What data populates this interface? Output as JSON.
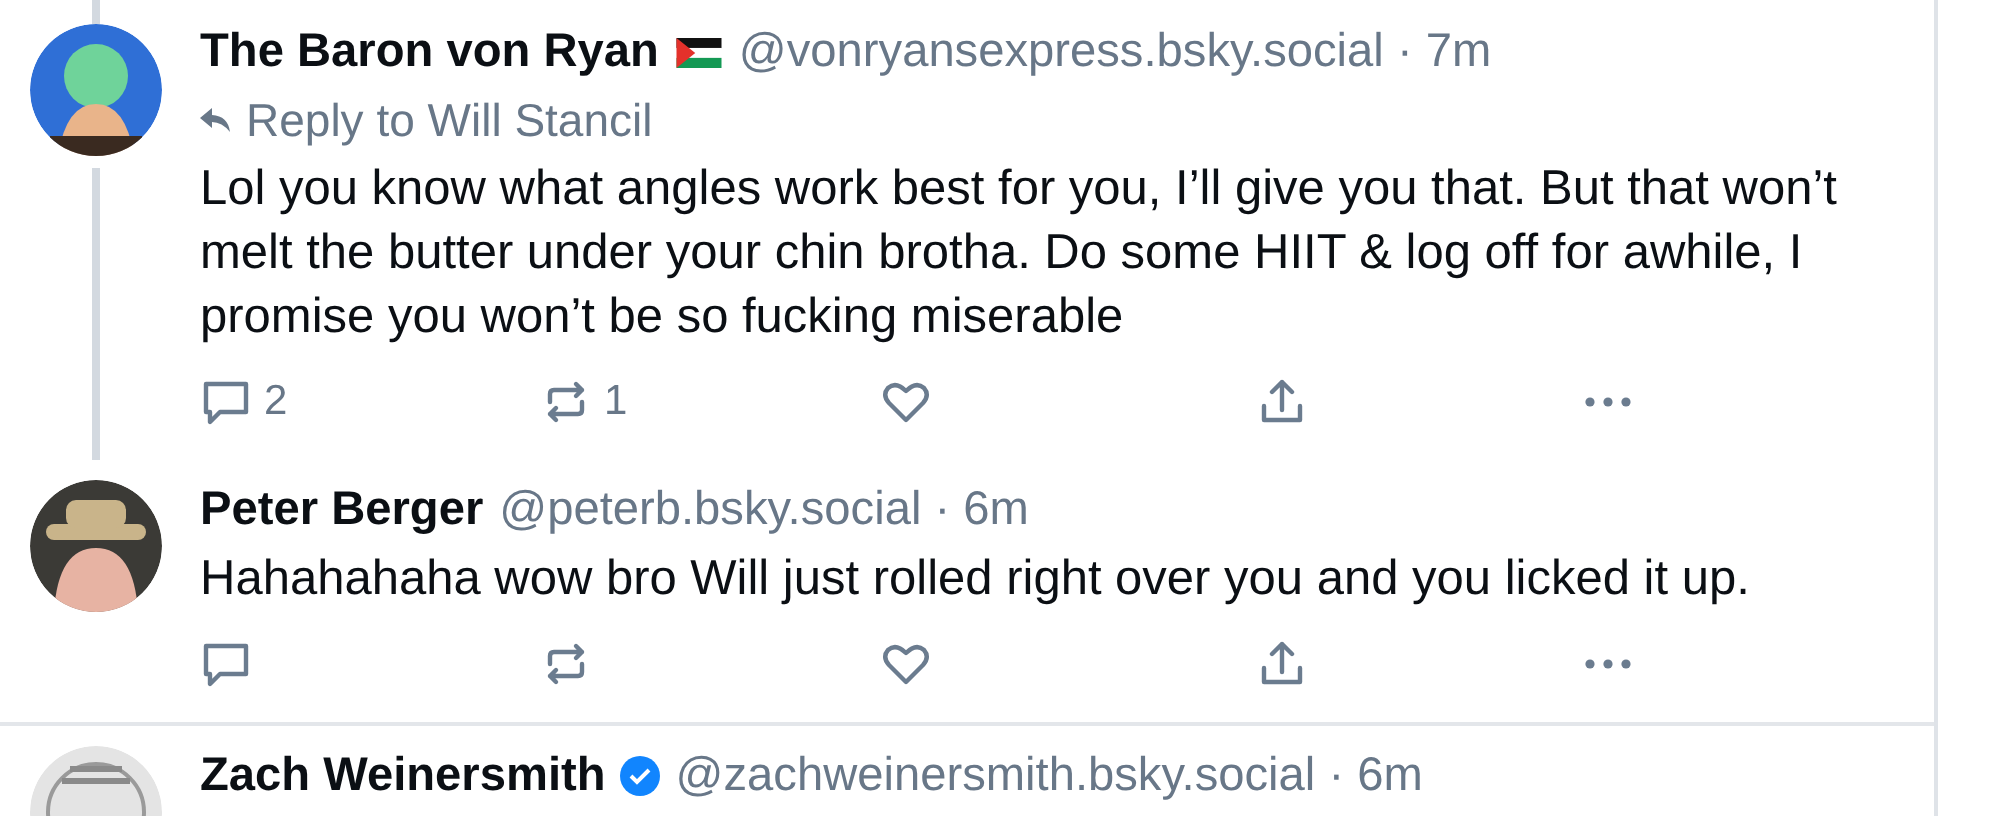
{
  "posts": [
    {
      "display_name": "The Baron von Ryan",
      "badge": {
        "kind": "flag"
      },
      "meta": "@vonryansexpress.bsky.social · 7m",
      "reply_to": "Reply to Will Stancil",
      "text": "Lol you know what angles work best for you, I’ll give you that. But that won’t melt the butter under your chin brotha. Do some HIIT & log off for awhile, I promise you won’t be so fucking miserable",
      "thread_line_above": true,
      "thread_line_below": true,
      "actions": [
        {
          "kind": "reply",
          "count": "2"
        },
        {
          "kind": "repost",
          "count": "1"
        },
        {
          "kind": "like"
        },
        {
          "kind": "share"
        },
        {
          "kind": "more"
        }
      ]
    },
    {
      "display_name": "Peter Berger",
      "meta": "@peterb.bsky.social · 6m",
      "text": "Hahahahaha wow bro Will just rolled right over you and you licked it up.",
      "thread_line_above": false,
      "thread_line_below": false,
      "actions": [
        {
          "kind": "reply"
        },
        {
          "kind": "repost"
        },
        {
          "kind": "like"
        },
        {
          "kind": "share"
        },
        {
          "kind": "more"
        }
      ]
    },
    {
      "display_name": "Zach Weinersmith",
      "badge": {
        "kind": "verified"
      },
      "meta": "@zachweinersmith.bsky.social · 6m",
      "thread_line_above": false,
      "thread_line_below": false
    }
  ]
}
